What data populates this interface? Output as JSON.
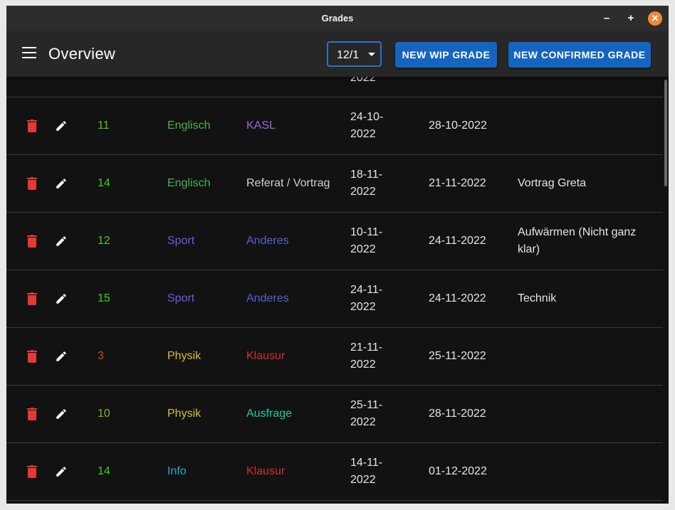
{
  "window": {
    "title": "Grades"
  },
  "titlebar_buttons": {
    "minimize": "–",
    "maximize": "+",
    "close": "✕"
  },
  "appbar": {
    "title": "Overview",
    "semester": "12/1",
    "new_wip": "NEW WIP GRADE",
    "new_confirmed": "NEW CONFIRMED GRADE"
  },
  "rows": [
    {
      "grade": "",
      "subject": "",
      "type": "",
      "date1": "2022",
      "date2": "",
      "note": "",
      "grade_color": "#4caf50",
      "subject_color": "#4caf50",
      "type_color": "#e6e6e6"
    },
    {
      "grade": "11",
      "subject": "Englisch",
      "type": "KASL",
      "date1": "24-10-2022",
      "date2": "28-10-2022",
      "note": "",
      "grade_color": "#5dbb2e",
      "subject_color": "#4caf50",
      "type_color": "#9c6ad0"
    },
    {
      "grade": "14",
      "subject": "Englisch",
      "type": "Referat / Vortrag",
      "date1": "18-11-2022",
      "date2": "21-11-2022",
      "note": "Vortrag Greta",
      "grade_color": "#3ccb2a",
      "subject_color": "#4caf50",
      "type_color": "#d0d0d0"
    },
    {
      "grade": "12",
      "subject": "Sport",
      "type": "Anderes",
      "date1": "10-11-2022",
      "date2": "24-11-2022",
      "note": "Aufwärmen (Nicht ganz klar)",
      "grade_color": "#52c22e",
      "subject_color": "#6a5ce0",
      "type_color": "#5a5fd0"
    },
    {
      "grade": "15",
      "subject": "Sport",
      "type": "Anderes",
      "date1": "24-11-2022",
      "date2": "24-11-2022",
      "note": "Technik",
      "grade_color": "#2ed12e",
      "subject_color": "#6a5ce0",
      "type_color": "#5a5fd0"
    },
    {
      "grade": "3",
      "subject": "Physik",
      "type": "Klausur",
      "date1": "21-11-2022",
      "date2": "25-11-2022",
      "note": "",
      "grade_color": "#c0521c",
      "subject_color": "#d4c02c",
      "type_color": "#d32f2f"
    },
    {
      "grade": "10",
      "subject": "Physik",
      "type": "Ausfrage",
      "date1": "25-11-2022",
      "date2": "28-11-2022",
      "note": "",
      "grade_color": "#7fb22a",
      "subject_color": "#d4c02c",
      "type_color": "#26c6a0"
    },
    {
      "grade": "14",
      "subject": "Info",
      "type": "Klausur",
      "date1": "14-11-2022",
      "date2": "01-12-2022",
      "note": "",
      "grade_color": "#3ccb2a",
      "subject_color": "#29a8c8",
      "type_color": "#d32f2f"
    }
  ]
}
